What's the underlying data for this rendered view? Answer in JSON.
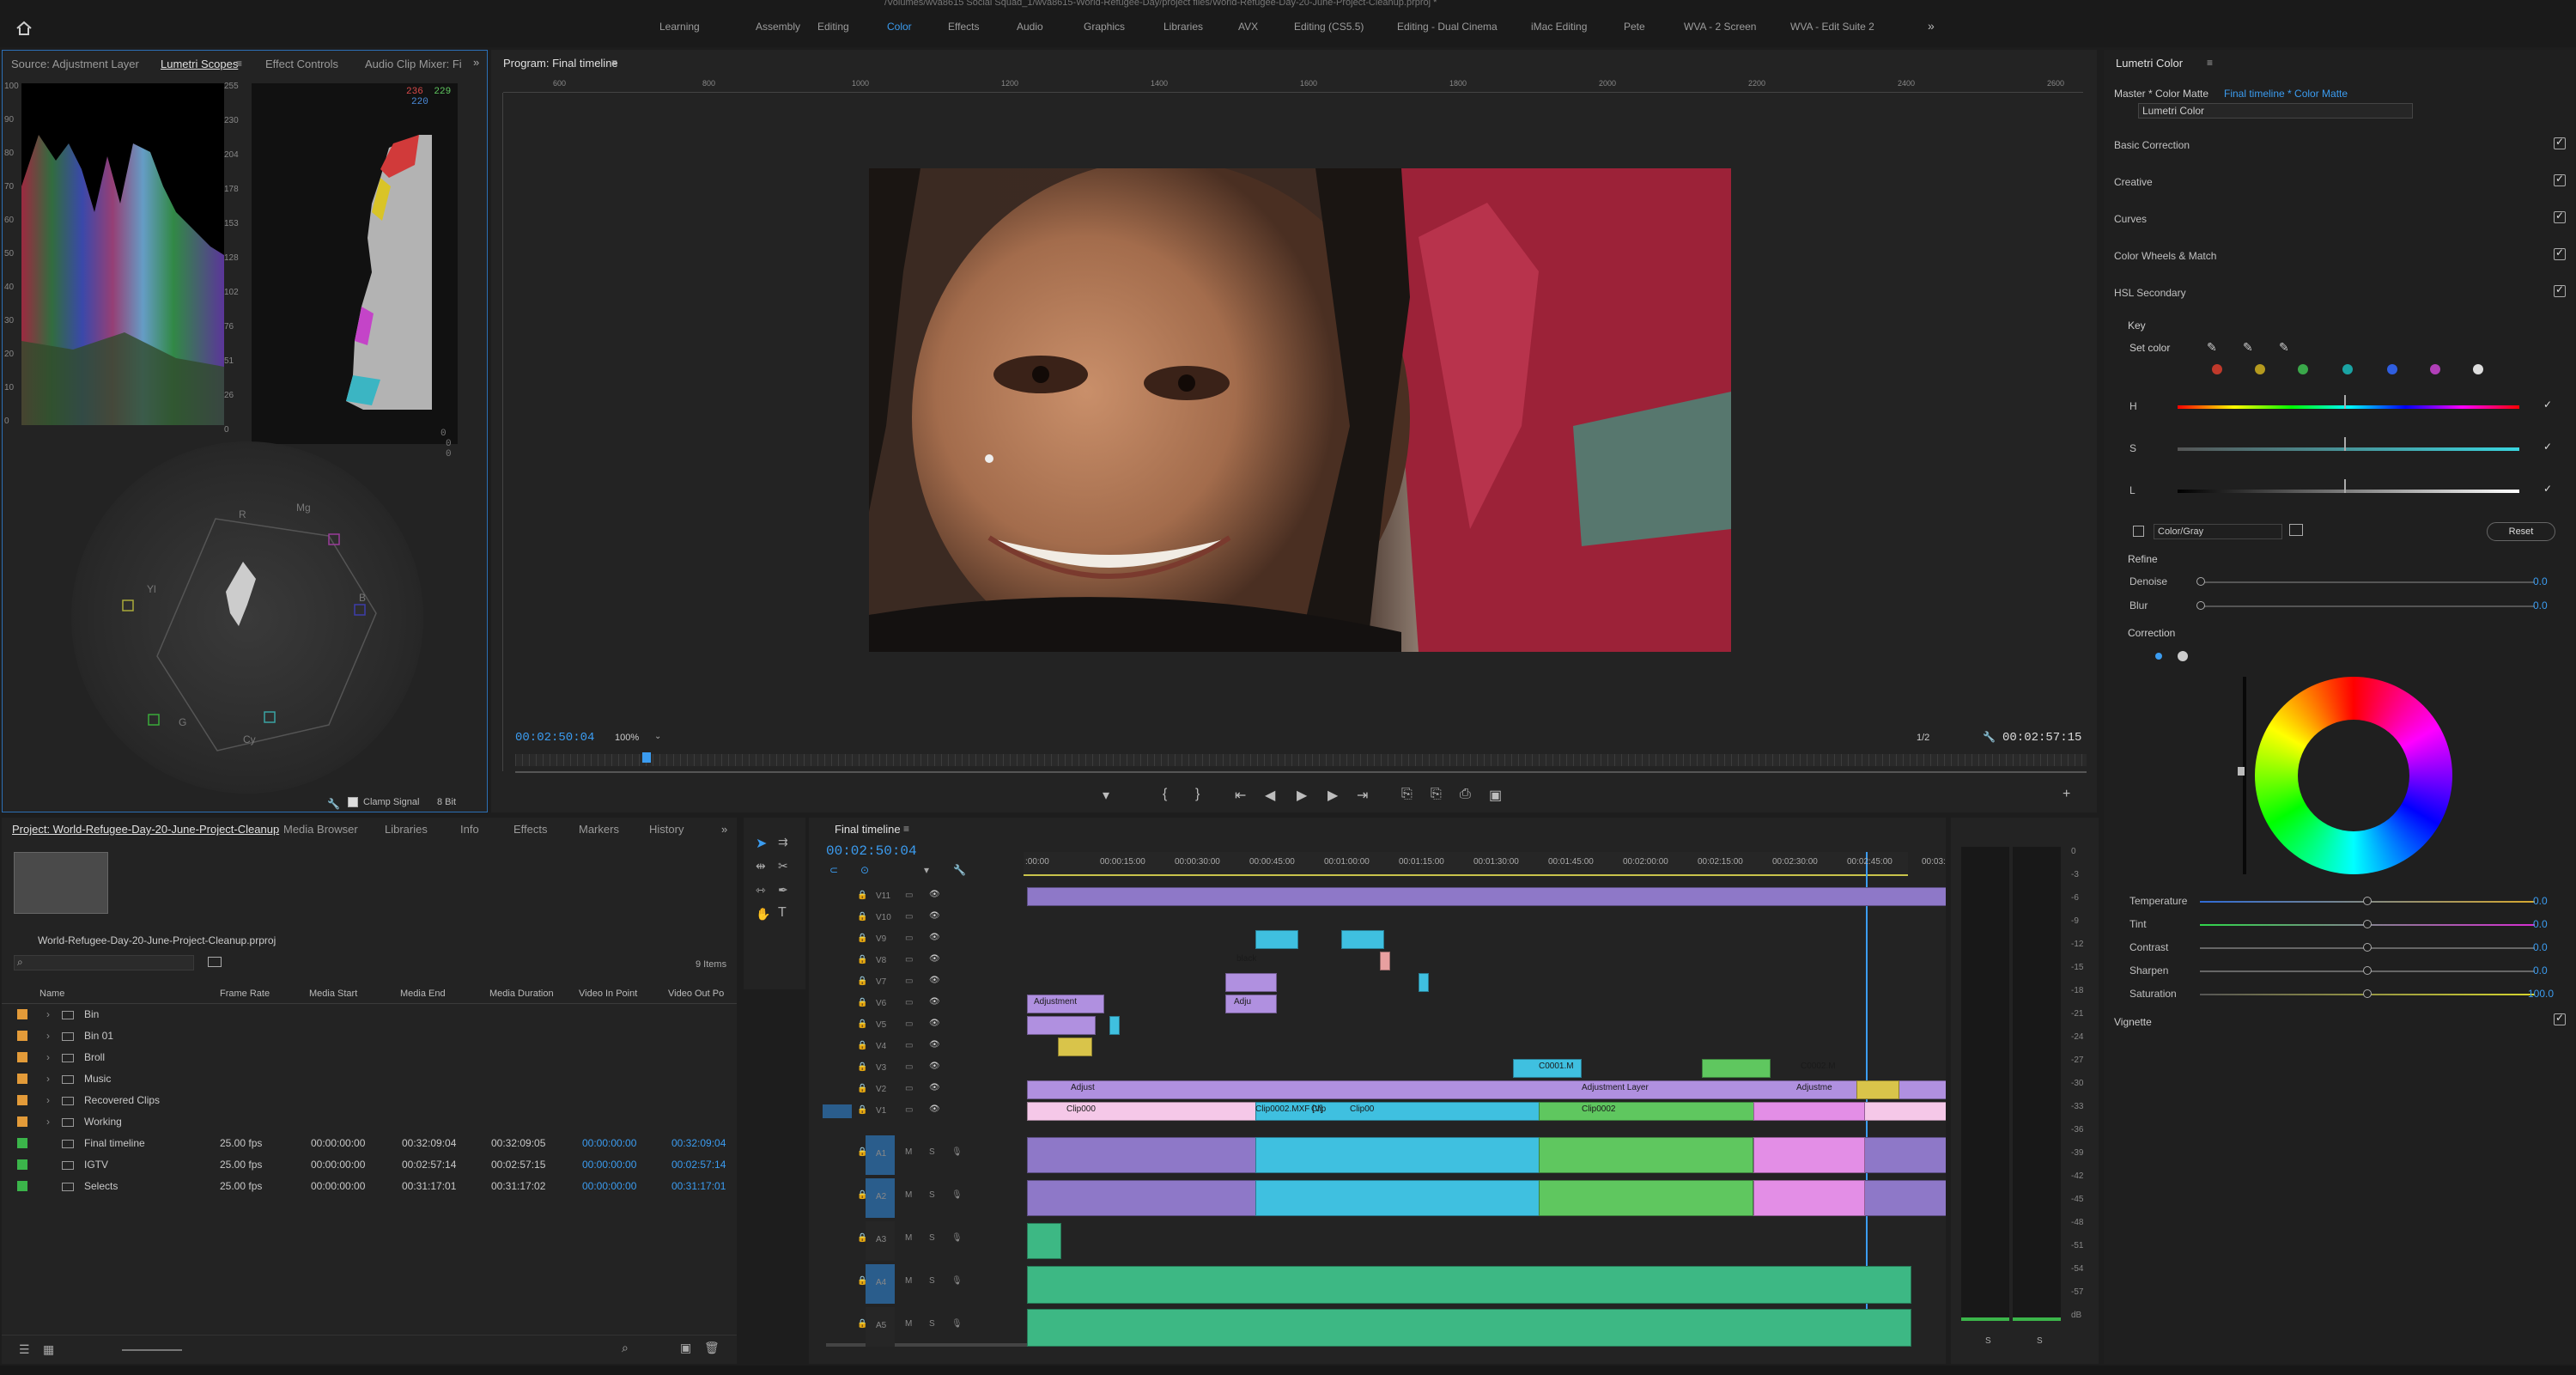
{
  "window": {
    "title": "/Volumes/wva8615 Social Squad_1/wva8615-World-Refugee-Day/project files/World-Refugee-Day-20-June-Project-Cleanup.prproj *"
  },
  "workspaces": [
    "Learning",
    "Assembly",
    "Editing",
    "Color",
    "Effects",
    "Audio",
    "Graphics",
    "Libraries",
    "AVX",
    "Editing (CS5.5)",
    "Editing - Dual Cinema",
    "iMac Editing",
    "Pete",
    "WVA - 2 Screen",
    "WVA - Edit Suite 2"
  ],
  "active_workspace": "Color",
  "source_panel": {
    "tabs": [
      "Source: Adjustment Layer",
      "Lumetri Scopes",
      "Effect Controls",
      "Audio Clip Mixer: Fi"
    ],
    "waveform_scale": [
      "100",
      "90",
      "80",
      "70",
      "60",
      "50",
      "40",
      "30",
      "20",
      "10",
      "0"
    ],
    "histogram_scale": [
      "255",
      "230",
      "204",
      "178",
      "153",
      "128",
      "102",
      "76",
      "51",
      "26",
      "0"
    ],
    "rgb_values": [
      "236",
      "229",
      "220"
    ],
    "rgb_bottom": [
      "0",
      "0",
      "0"
    ],
    "vector_labels": [
      "R",
      "Mg",
      "B",
      "Cy",
      "G",
      "Yl"
    ],
    "clamp_signal": "Clamp Signal",
    "bit_depth": "8 Bit"
  },
  "program": {
    "title": "Program: Final timeline",
    "ruler": [
      "600",
      "800",
      "1000",
      "1200",
      "1400",
      "1600",
      "1800",
      "2000",
      "2200",
      "2400",
      "2600"
    ],
    "timecode": "00:02:50:04",
    "zoom": "100%",
    "resolution": "1/2",
    "duration": "00:02:57:15"
  },
  "lumetri": {
    "title": "Lumetri Color",
    "master": "Master * Color Matte",
    "clip": "Final timeline * Color Matte",
    "effect": "Lumetri Color",
    "sections": [
      "Basic Correction",
      "Creative",
      "Curves",
      "Color Wheels & Match",
      "HSL Secondary"
    ],
    "key_label": "Key",
    "set_color": "Set color",
    "hsl": [
      "H",
      "S",
      "L"
    ],
    "color_gray": "Color/Gray",
    "reset": "Reset",
    "refine": "Refine",
    "denoise": {
      "label": "Denoise",
      "value": "0.0"
    },
    "blur": {
      "label": "Blur",
      "value": "0.0"
    },
    "correction": "Correction",
    "sliders": [
      {
        "label": "Temperature",
        "value": "0.0"
      },
      {
        "label": "Tint",
        "value": "0.0"
      },
      {
        "label": "Contrast",
        "value": "0.0"
      },
      {
        "label": "Sharpen",
        "value": "0.0"
      },
      {
        "label": "Saturation",
        "value": "100.0"
      }
    ],
    "vignette": "Vignette",
    "swatch_colors": [
      "#c0392b",
      "#b59a1e",
      "#3aa84a",
      "#1aa3a3",
      "#2f5ee0",
      "#b13fb8",
      "#dddddd"
    ]
  },
  "project": {
    "tabs": [
      "Project: World-Refugee-Day-20-June-Project-Cleanup",
      "Media Browser",
      "Libraries",
      "Info",
      "Effects",
      "Markers",
      "History"
    ],
    "file": "World-Refugee-Day-20-June-Project-Cleanup.prproj",
    "items_count": "9 Items",
    "columns": [
      "Name",
      "Frame Rate",
      "Media Start",
      "Media End",
      "Media Duration",
      "Video In Point",
      "Video Out Po"
    ],
    "bins": [
      "Bin",
      "Bin 01",
      "Broll",
      "Music",
      "Recovered Clips",
      "Working"
    ],
    "sequences": [
      {
        "name": "Final timeline",
        "fps": "25.00 fps",
        "start": "00:00:00:00",
        "end": "00:32:09:04",
        "duration": "00:32:09:05",
        "in": "00:00:00:00",
        "out": "00:32:09:04"
      },
      {
        "name": "IGTV",
        "fps": "25.00 fps",
        "start": "00:00:00:00",
        "end": "00:02:57:14",
        "duration": "00:02:57:15",
        "in": "00:00:00:00",
        "out": "00:02:57:14"
      },
      {
        "name": "Selects",
        "fps": "25.00 fps",
        "start": "00:00:00:00",
        "end": "00:31:17:01",
        "duration": "00:31:17:02",
        "in": "00:00:00:00",
        "out": "00:31:17:01"
      }
    ]
  },
  "timeline": {
    "title": "Final timeline",
    "timecode": "00:02:50:04",
    "ruler": [
      ":00:00",
      "00:00:15:00",
      "00:00:30:00",
      "00:00:45:00",
      "00:01:00:00",
      "00:01:15:00",
      "00:01:30:00",
      "00:01:45:00",
      "00:02:00:00",
      "00:02:15:00",
      "00:02:30:00",
      "00:02:45:00",
      "00:03:0"
    ],
    "video_tracks": [
      "V11",
      "V10",
      "V9",
      "V8",
      "V7",
      "V6",
      "V5",
      "V4",
      "V3",
      "V2",
      "V1"
    ],
    "audio_tracks": [
      "A1",
      "A2",
      "A3",
      "A4",
      "A5"
    ],
    "clip_labels": [
      "Adjustment",
      "Adju",
      "black",
      "Adjust",
      "Clip000",
      "Clip0002.MXF [V]",
      "Clip",
      "Clip00",
      "Adjustment Layer",
      "C0001.M",
      "Clip0002",
      "C0002.M",
      "Adjustme"
    ]
  },
  "audio_meter": {
    "scale": [
      "0",
      "-3",
      "-6",
      "-9",
      "-12",
      "-15",
      "-18",
      "-21",
      "-24",
      "-27",
      "-30",
      "-33",
      "-36",
      "-39",
      "-42",
      "-45",
      "-48",
      "-51",
      "-54",
      "-57",
      "dB"
    ],
    "solo": [
      "S",
      "S"
    ]
  }
}
